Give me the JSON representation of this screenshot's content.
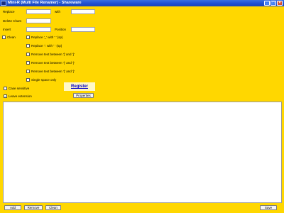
{
  "window": {
    "title": "Mini-R (Multi File Renamer) - Shareware",
    "minimize_glyph": "_",
    "maximize_glyph": "□",
    "close_glyph": "×"
  },
  "form": {
    "replace_label": "Replace",
    "with_label": "with",
    "delete_chars_label": "Delete Chars",
    "insert_label": "Insert",
    "position_label": "Position",
    "clean_label": "Clean"
  },
  "options": [
    {
      "label": "Replace '_' with ' ' (sp)",
      "checked": false
    },
    {
      "label": "Replace '.' with ' ' (sp)",
      "checked": false
    },
    {
      "label": "Remove text between '[' and ']'",
      "checked": false
    },
    {
      "label": "Remove text between '(' and ')'",
      "checked": false
    },
    {
      "label": "Remove text between '{' and '}'",
      "checked": false
    },
    {
      "label": "Single space only",
      "checked": false
    }
  ],
  "case_sensitive_label": "Case sensitive",
  "case_sensitive_checked": false,
  "leave_extension_label": "Leave extension",
  "leave_extension_checked": true,
  "register_label": "Register",
  "properties_label": "Properties",
  "footer": {
    "add_label": "Add",
    "remove_label": "Remove",
    "clean_label": "Clean",
    "save_label": "Save"
  },
  "check_glyph": "✓"
}
